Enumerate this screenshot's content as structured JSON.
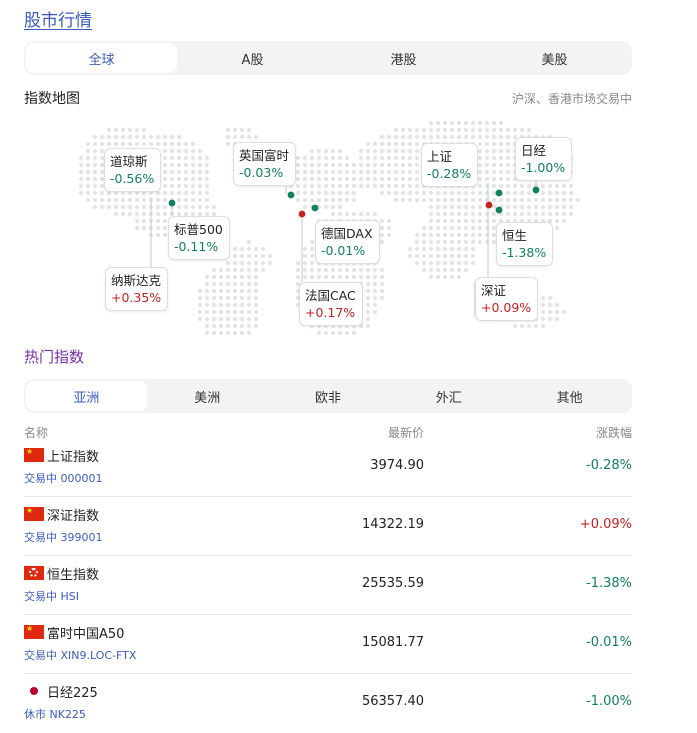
{
  "page": {
    "title": "股市行情"
  },
  "market_tabs": [
    {
      "label": "全球",
      "active": true
    },
    {
      "label": "A股",
      "active": false
    },
    {
      "label": "港股",
      "active": false
    },
    {
      "label": "美股",
      "active": false
    }
  ],
  "map": {
    "title": "指数地图",
    "status": "沪深、香港市场交易中",
    "cards": [
      {
        "name": "道琼斯",
        "change": "-0.56%",
        "direction": "down"
      },
      {
        "name": "标普500",
        "change": "-0.11%",
        "direction": "down"
      },
      {
        "name": "纳斯达克",
        "change": "+0.35%",
        "direction": "up"
      },
      {
        "name": "英国富时",
        "change": "-0.03%",
        "direction": "down"
      },
      {
        "name": "德国DAX",
        "change": "-0.01%",
        "direction": "down"
      },
      {
        "name": "法国CAC",
        "change": "+0.17%",
        "direction": "up"
      },
      {
        "name": "上证",
        "change": "-0.28%",
        "direction": "down"
      },
      {
        "name": "日经",
        "change": "-1.00%",
        "direction": "down"
      },
      {
        "name": "恒生",
        "change": "-1.38%",
        "direction": "down"
      },
      {
        "name": "深证",
        "change": "+0.09%",
        "direction": "up"
      }
    ]
  },
  "hot": {
    "title": "热门指数",
    "region_tabs": [
      {
        "label": "亚洲",
        "active": true
      },
      {
        "label": "美洲",
        "active": false
      },
      {
        "label": "欧非",
        "active": false
      },
      {
        "label": "外汇",
        "active": false
      },
      {
        "label": "其他",
        "active": false
      }
    ],
    "columns": {
      "name": "名称",
      "price": "最新价",
      "change": "涨跌幅"
    },
    "rows": [
      {
        "flag": "cn",
        "name": "上证指数",
        "status_code": "交易中 000001",
        "price": "3974.90",
        "change": "-0.28%",
        "direction": "down"
      },
      {
        "flag": "cn",
        "name": "深证指数",
        "status_code": "交易中 399001",
        "price": "14322.19",
        "change": "+0.09%",
        "direction": "up"
      },
      {
        "flag": "hk",
        "name": "恒生指数",
        "status_code": "交易中 HSI",
        "price": "25535.59",
        "change": "-1.38%",
        "direction": "down"
      },
      {
        "flag": "cn",
        "name": "富时中国A50",
        "status_code": "交易中 XIN9.LOC-FTX",
        "price": "15081.77",
        "change": "-0.01%",
        "direction": "down"
      },
      {
        "flag": "jp",
        "name": "日经225",
        "status_code": "休市 NK225",
        "price": "56357.40",
        "change": "-1.00%",
        "direction": "down"
      }
    ]
  },
  "colors": {
    "down": "#12805c",
    "up": "#c5221f",
    "accent": "#3b5bbf",
    "hot_title": "#7b2fa8"
  }
}
